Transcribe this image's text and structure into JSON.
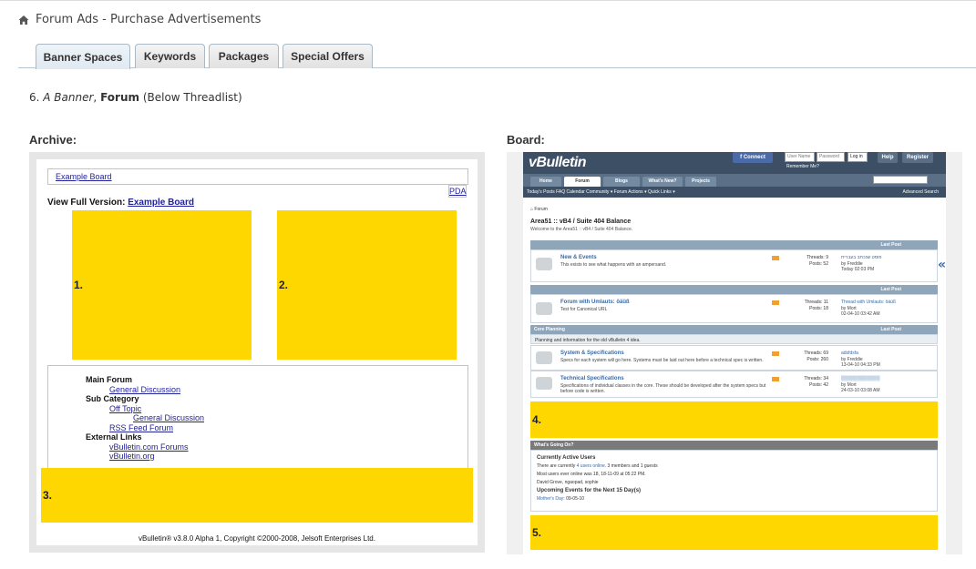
{
  "header": {
    "title": "Forum Ads - Purchase Advertisements"
  },
  "tabs": [
    {
      "label": "Banner Spaces",
      "active": true
    },
    {
      "label": "Keywords",
      "active": false
    },
    {
      "label": "Packages",
      "active": false
    },
    {
      "label": "Special Offers",
      "active": false
    }
  ],
  "subtitle": {
    "num": "6.",
    "italic": "A Banner",
    "sep": ",",
    "bold": "Forum",
    "rest": "(Below Threadlist)"
  },
  "archive": {
    "label": "Archive:",
    "nav_link": "Example Board",
    "pda": "PDA",
    "view_full_prefix": "View Full Version:",
    "view_full_link": "Example Board",
    "ads": [
      "1.",
      "2.",
      "3."
    ],
    "list": [
      {
        "text": "Main Forum",
        "type": "h",
        "indent": 0
      },
      {
        "text": "General Discussion",
        "type": "link",
        "indent": 1
      },
      {
        "text": "Sub Category",
        "type": "h",
        "indent": 0
      },
      {
        "text": "Off Topic",
        "type": "link",
        "indent": 1
      },
      {
        "text": "General Discussion",
        "type": "link",
        "indent": 2
      },
      {
        "text": "RSS Feed Forum",
        "type": "link",
        "indent": 1
      },
      {
        "text": "External Links",
        "type": "h",
        "indent": 0
      },
      {
        "text": "vBulletin.com Forums",
        "type": "link",
        "indent": 1
      },
      {
        "text": "vBulletin.org",
        "type": "link",
        "indent": 1
      }
    ],
    "copyright": "vBulletin® v3.8.0 Alpha 1, Copyright ©2000-2008, Jelsoft Enterprises Ltd."
  },
  "board": {
    "label": "Board:",
    "logo": "vBulletin",
    "connect": "f Connect",
    "user_name": "User Name",
    "password": "Password",
    "login": "Log in",
    "remember": "Remember Me?",
    "help": "Help",
    "register": "Register",
    "nav_tabs": [
      "Home",
      "Forum",
      "Blogs",
      "What's New?",
      "Projects"
    ],
    "subnav": "Today's Posts   FAQ   Calendar   Community ▾   Forum Actions ▾   Quick Links ▾",
    "advanced_search": "Advanced Search",
    "crumb": "Forum",
    "title": "Area51 :: vB4 / Suite 404 Balance",
    "welcome": "Welcome to the Area51 :: vB4 / Suite 404 Balance.",
    "last_post": "Last Post",
    "core_planning": "Core Planning",
    "core_planning_desc": "Planning and information for the old vBulletin 4 idea.",
    "forums": [
      {
        "name": "New & Events",
        "desc": "This exists to see what happens with an ampersand.",
        "threads": "Threads: 9",
        "posts": "Posts: 52",
        "lp_title": "פוסט שנכתב בעברית",
        "lp_by": "by Freddie",
        "lp_date": "Today 02:03 PM"
      },
      {
        "name": "Forum with Umlauts: öäüß",
        "desc": "Test for Canonical URL",
        "threads": "Threads: 11",
        "posts": "Posts: 18",
        "lp_title": "Thread with Umlauts: öäüß",
        "lp_by": "by Mort",
        "lp_date": "02-04-10 03:42 AM"
      },
      {
        "name": "System & Specifications",
        "desc": "Specs for each system will go here. Systems must be laid out here before a technical spec is written.",
        "threads": "Threads: 69",
        "posts": "Posts: 260",
        "lp_title": "adsfdsfa",
        "lp_by": "by Freddie",
        "lp_date": "13-04-10 04:33 PM"
      },
      {
        "name": "Technical Specifications",
        "desc": "Specifications of individual classes in the core. These should be developed after the system specs but before code is written.",
        "threads": "Threads: 34",
        "posts": "Posts: 42",
        "lp_title": "▒▒▒▒▒▒▒▒▒▒▒▒",
        "lp_by": "by Mort",
        "lp_date": "24-03-10 03:08 AM"
      }
    ],
    "ads": [
      "4.",
      "5."
    ],
    "wgo_head": "What's Going On?",
    "active_users_title": "Currently Active Users",
    "active_users_line_pre": "There are currently",
    "active_users_link": "4 users online",
    "active_users_line_post": ". 3 members and 1 guests",
    "most_users": "Most users ever online was 18, 18-11-09 at 05:22 PM.",
    "users": "David Grove, ngaopad, sophie",
    "events_title": "Upcoming Events for the Next 15 Day(s)",
    "event_link": "Mother's Day",
    "event_date": ": 09-05-10"
  },
  "colors": {
    "ad_yellow": "#ffd700",
    "tab_border": "#aab9c4",
    "vb_header": "#3d4f64"
  }
}
